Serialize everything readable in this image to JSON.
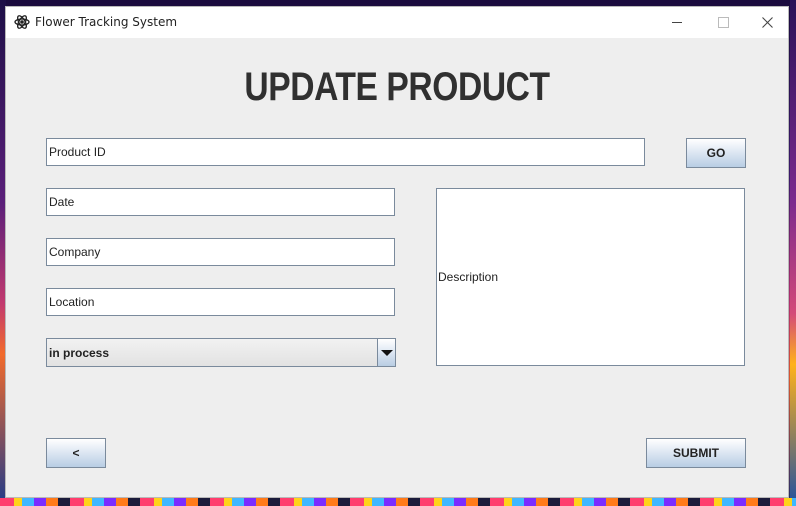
{
  "window": {
    "title": "Flower Tracking System",
    "app_icon": "flower-icon"
  },
  "form": {
    "heading": "UPDATE PRODUCT",
    "product_id": "Product ID",
    "go_label": "GO",
    "date": "Date",
    "company": "Company",
    "location": "Location",
    "status_selected": "in process",
    "description": "Description",
    "back_label": "<",
    "submit_label": "SUBMIT"
  }
}
